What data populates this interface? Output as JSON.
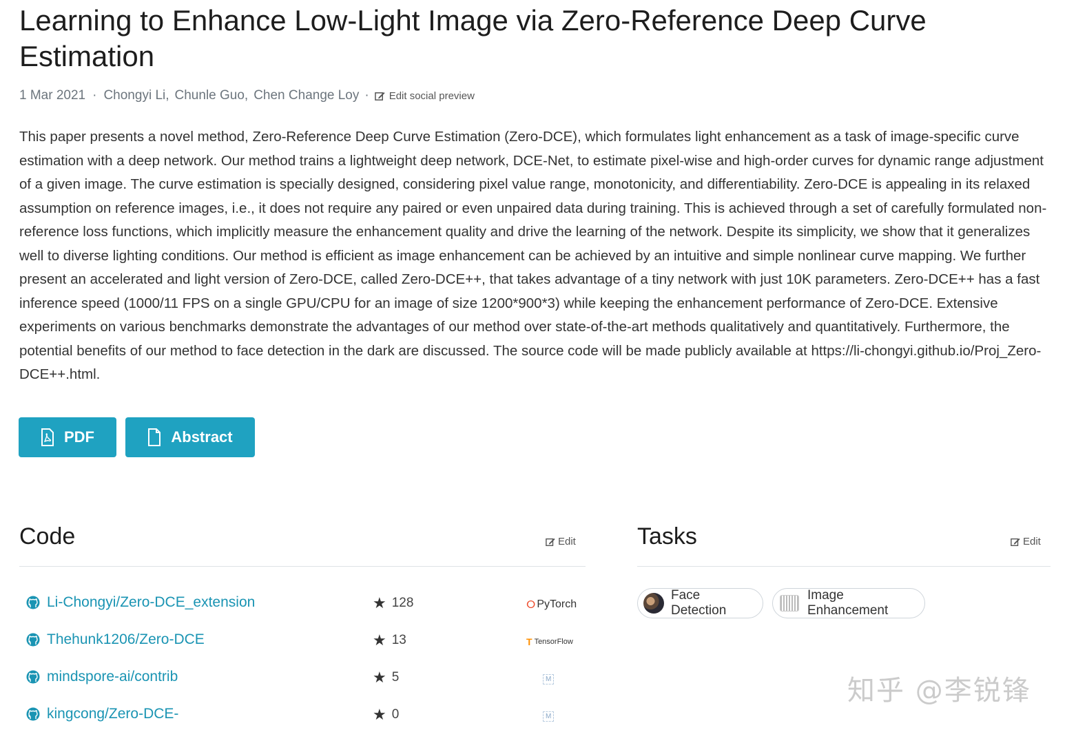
{
  "paper": {
    "title": "Learning to Enhance Low-Light Image via Zero-Reference Deep Curve Estimation",
    "date": "1 Mar 2021",
    "authors": [
      "Chongyi Li,",
      "Chunle Guo,",
      "Chen Change Loy"
    ],
    "edit_social_label": "Edit social preview",
    "abstract": "This paper presents a novel method, Zero-Reference Deep Curve Estimation (Zero-DCE), which formulates light enhancement as a task of image-specific curve estimation with a deep network. Our method trains a lightweight deep network, DCE-Net, to estimate pixel-wise and high-order curves for dynamic range adjustment of a given image. The curve estimation is specially designed, considering pixel value range, monotonicity, and differentiability. Zero-DCE is appealing in its relaxed assumption on reference images, i.e., it does not require any paired or even unpaired data during training. This is achieved through a set of carefully formulated non-reference loss functions, which implicitly measure the enhancement quality and drive the learning of the network. Despite its simplicity, we show that it generalizes well to diverse lighting conditions. Our method is efficient as image enhancement can be achieved by an intuitive and simple nonlinear curve mapping. We further present an accelerated and light version of Zero-DCE, called Zero-DCE++, that takes advantage of a tiny network with just 10K parameters. Zero-DCE++ has a fast inference speed (1000/11 FPS on a single GPU/CPU for an image of size 1200*900*3) while keeping the enhancement performance of Zero-DCE. Extensive experiments on various benchmarks demonstrate the advantages of our method over state-of-the-art methods qualitatively and quantitatively. Furthermore, the potential benefits of our method to face detection in the dark are discussed. The source code will be made publicly available at https://li-chongyi.github.io/Proj_Zero-DCE++.html."
  },
  "buttons": {
    "pdf": "PDF",
    "abstract": "Abstract"
  },
  "code": {
    "title": "Code",
    "edit": "Edit",
    "repos": [
      {
        "name": "Li-Chongyi/Zero-DCE_extension",
        "stars": "128",
        "framework": "PyTorch"
      },
      {
        "name": "Thehunk1206/Zero-DCE",
        "stars": "13",
        "framework": "TensorFlow"
      },
      {
        "name": "mindspore-ai/contrib",
        "stars": "5",
        "framework": "M"
      },
      {
        "name": "kingcong/Zero-DCE-",
        "stars": "0",
        "framework": "M"
      }
    ]
  },
  "tasks": {
    "title": "Tasks",
    "edit": "Edit",
    "items": [
      "Face Detection",
      "Image Enhancement"
    ]
  },
  "watermark": "知乎 @李锐锋",
  "colors": {
    "accent": "#1fa2c1",
    "link": "#1a94b3"
  }
}
